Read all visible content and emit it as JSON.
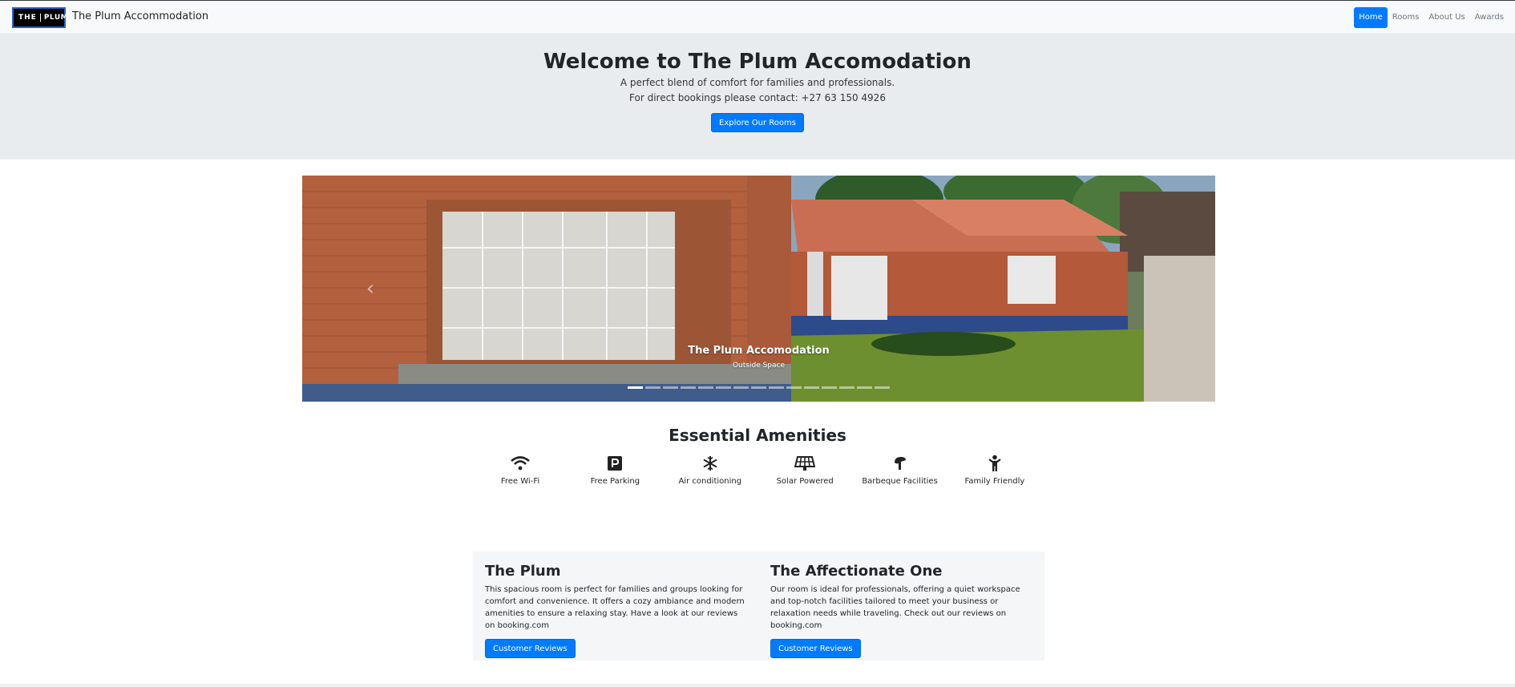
{
  "brand": {
    "logo_left": "THE",
    "logo_right": "PLUM",
    "name": "The Plum Accommodation"
  },
  "nav": {
    "items": [
      "Home",
      "Rooms",
      "About Us",
      "Awards"
    ],
    "active": "Home"
  },
  "hero": {
    "title": "Welcome to The Plum Accomodation",
    "line1": "A perfect blend of comfort for families and professionals.",
    "line2": "For direct bookings please contact: +27 63 150 4926",
    "button": "Explore Our Rooms"
  },
  "carousel": {
    "caption_title": "The Plum Accomodation",
    "caption_subtitle": "Outside Space",
    "prev_icon": "chevron-left-icon",
    "indicator_count": 15,
    "active_indicator": 0
  },
  "amenities": {
    "title": "Essential Amenities",
    "items": [
      {
        "label": "Free Wi-Fi",
        "icon": "wifi-icon"
      },
      {
        "label": "Free Parking",
        "icon": "parking-icon"
      },
      {
        "label": "Air conditioning",
        "icon": "snowflake-icon"
      },
      {
        "label": "Solar Powered",
        "icon": "solar-panel-icon"
      },
      {
        "label": "Barbeque Facilities",
        "icon": "barbeque-icon"
      },
      {
        "label": "Family Friendly",
        "icon": "child-icon"
      }
    ]
  },
  "rooms": [
    {
      "title": "The Plum",
      "description": "This spacious room is perfect for families and groups looking for comfort and convenience. It offers a cozy ambiance and modern amenities to ensure a relaxing stay. Have a look at our reviews on booking.com",
      "button": "Customer Reviews"
    },
    {
      "title": "The Affectionate One",
      "description": "Our room is ideal for professionals, offering a quiet workspace and top-notch facilities tailored to meet your business or relaxation needs while traveling. Check out our reviews on booking.com",
      "button": "Customer Reviews"
    }
  ],
  "colors": {
    "primary": "#007bff",
    "hero_bg": "#e9ecef",
    "navbar_bg": "#f8f9fa"
  }
}
